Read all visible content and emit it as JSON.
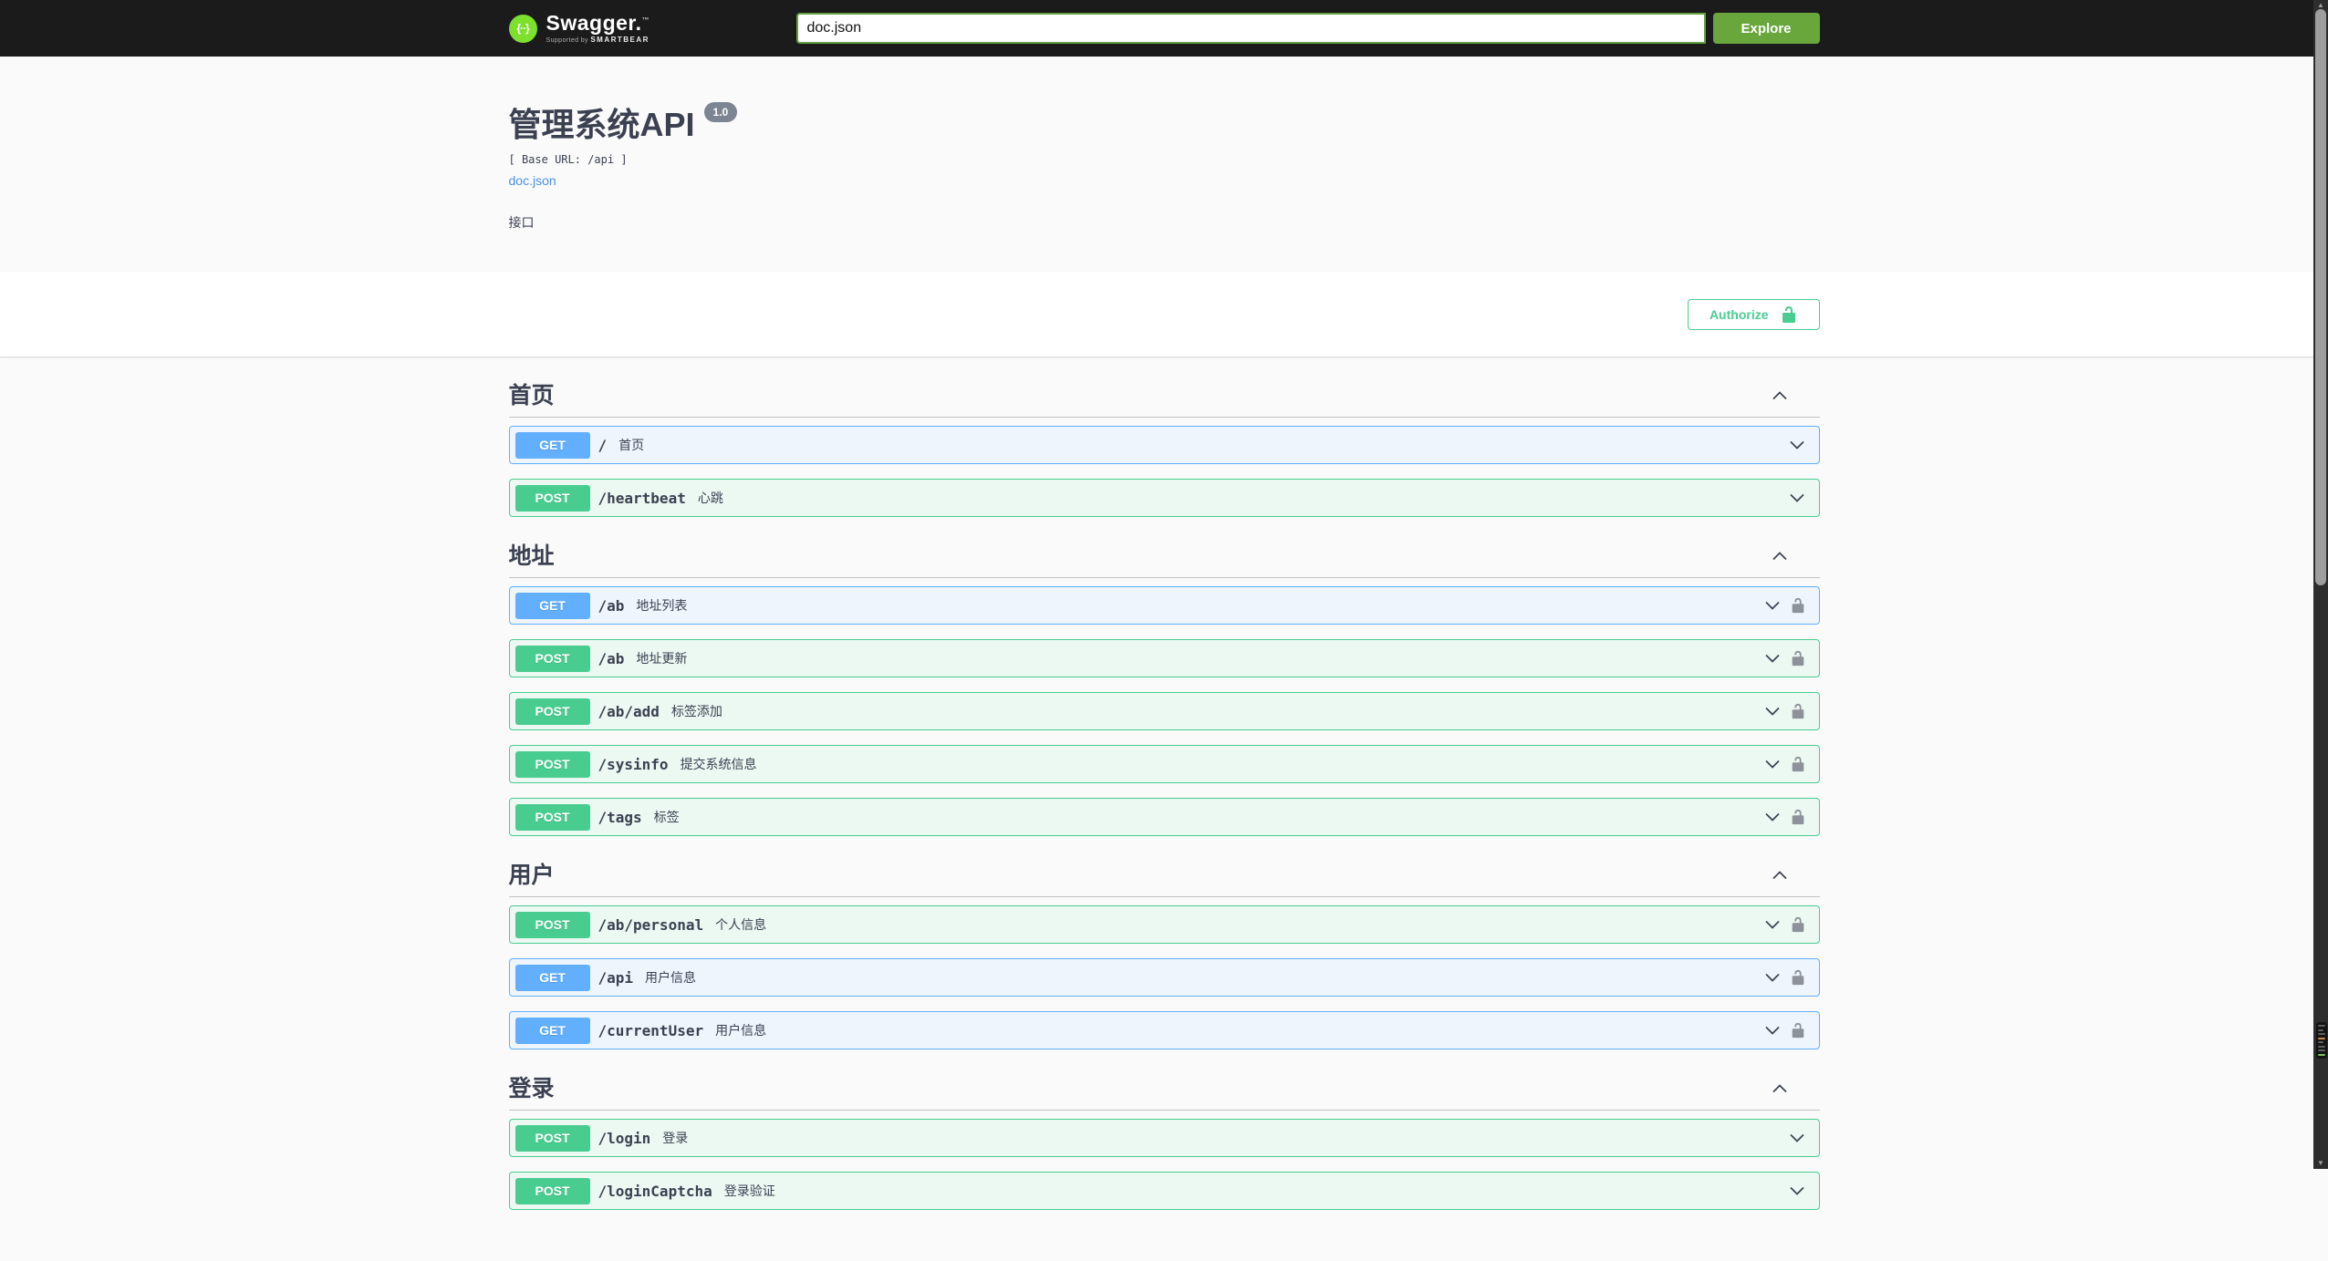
{
  "topbar": {
    "logo_text": "Swagger.",
    "logo_tm": "™",
    "logo_supported_by": "Supported by",
    "logo_brand": "SMARTBEAR",
    "search_value": "doc.json",
    "explore_label": "Explore"
  },
  "info": {
    "title": "管理系统API",
    "version": "1.0",
    "base_url": "[ Base URL: /api ]",
    "spec_link": "doc.json",
    "description": "接口"
  },
  "auth": {
    "authorize_label": "Authorize"
  },
  "colors": {
    "topbar_bg": "#1b1b1b",
    "explore_green": "#69a63c",
    "method_get": "#61affe",
    "method_post": "#49cc90",
    "accent_green": "#49cc90",
    "link_blue": "#4990e2",
    "text_dark": "#3b4151",
    "version_badge": "#7d8492",
    "page_bg": "#fafafa"
  },
  "sections": [
    {
      "name": "首页",
      "operations": [
        {
          "method": "GET",
          "path": "/",
          "summary": "首页",
          "locked": false
        },
        {
          "method": "POST",
          "path": "/heartbeat",
          "summary": "心跳",
          "locked": false
        }
      ]
    },
    {
      "name": "地址",
      "operations": [
        {
          "method": "GET",
          "path": "/ab",
          "summary": "地址列表",
          "locked": true
        },
        {
          "method": "POST",
          "path": "/ab",
          "summary": "地址更新",
          "locked": true
        },
        {
          "method": "POST",
          "path": "/ab/add",
          "summary": "标签添加",
          "locked": true
        },
        {
          "method": "POST",
          "path": "/sysinfo",
          "summary": "提交系统信息",
          "locked": true
        },
        {
          "method": "POST",
          "path": "/tags",
          "summary": "标签",
          "locked": true
        }
      ]
    },
    {
      "name": "用户",
      "operations": [
        {
          "method": "POST",
          "path": "/ab/personal",
          "summary": "个人信息",
          "locked": true
        },
        {
          "method": "GET",
          "path": "/api",
          "summary": "用户信息",
          "locked": true
        },
        {
          "method": "GET",
          "path": "/currentUser",
          "summary": "用户信息",
          "locked": true
        }
      ]
    },
    {
      "name": "登录",
      "operations": [
        {
          "method": "POST",
          "path": "/login",
          "summary": "登录",
          "locked": false
        },
        {
          "method": "POST",
          "path": "/loginCaptcha",
          "summary": "登录验证",
          "locked": false
        }
      ]
    }
  ]
}
